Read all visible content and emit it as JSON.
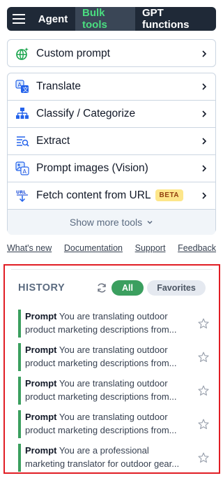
{
  "nav": {
    "menu_icon": "hamburger-icon",
    "tabs": [
      {
        "label": "Agent"
      },
      {
        "label": "Bulk tools"
      },
      {
        "label": "GPT functions"
      }
    ]
  },
  "custom_prompt": {
    "label": "Custom prompt",
    "icon": "globe-sparkle-icon"
  },
  "tools": [
    {
      "label": "Translate",
      "icon": "translate-icon"
    },
    {
      "label": "Classify / Categorize",
      "icon": "hierarchy-icon"
    },
    {
      "label": "Extract",
      "icon": "extract-icon"
    },
    {
      "label": "Prompt images (Vision)",
      "icon": "image-text-icon"
    },
    {
      "label": "Fetch content from URL",
      "icon": "url-download-icon",
      "badge": "BETA"
    }
  ],
  "show_more": "Show more tools",
  "links": [
    "What's new",
    "Documentation",
    "Support",
    "Feedback"
  ],
  "history": {
    "title": "HISTORY",
    "filter_all": "All",
    "filter_favorites": "Favorites",
    "items": [
      {
        "prefix": "Prompt",
        "line1": "You are translating outdoor",
        "line2": "product marketing descriptions from..."
      },
      {
        "prefix": "Prompt",
        "line1": "You are translating outdoor",
        "line2": "product marketing descriptions from..."
      },
      {
        "prefix": "Prompt",
        "line1": "You are translating outdoor",
        "line2": "product marketing descriptions from..."
      },
      {
        "prefix": "Prompt",
        "line1": "You are translating outdoor",
        "line2": "product marketing descriptions from..."
      },
      {
        "prefix": "Prompt",
        "line1": "You are a professional",
        "line2": "marketing translator for outdoor gear..."
      }
    ]
  },
  "colors": {
    "accent_green": "#3b9f5f",
    "nav_bg": "#1f2937",
    "highlight_border": "#e11d24",
    "beta_bg": "#fde68a"
  }
}
